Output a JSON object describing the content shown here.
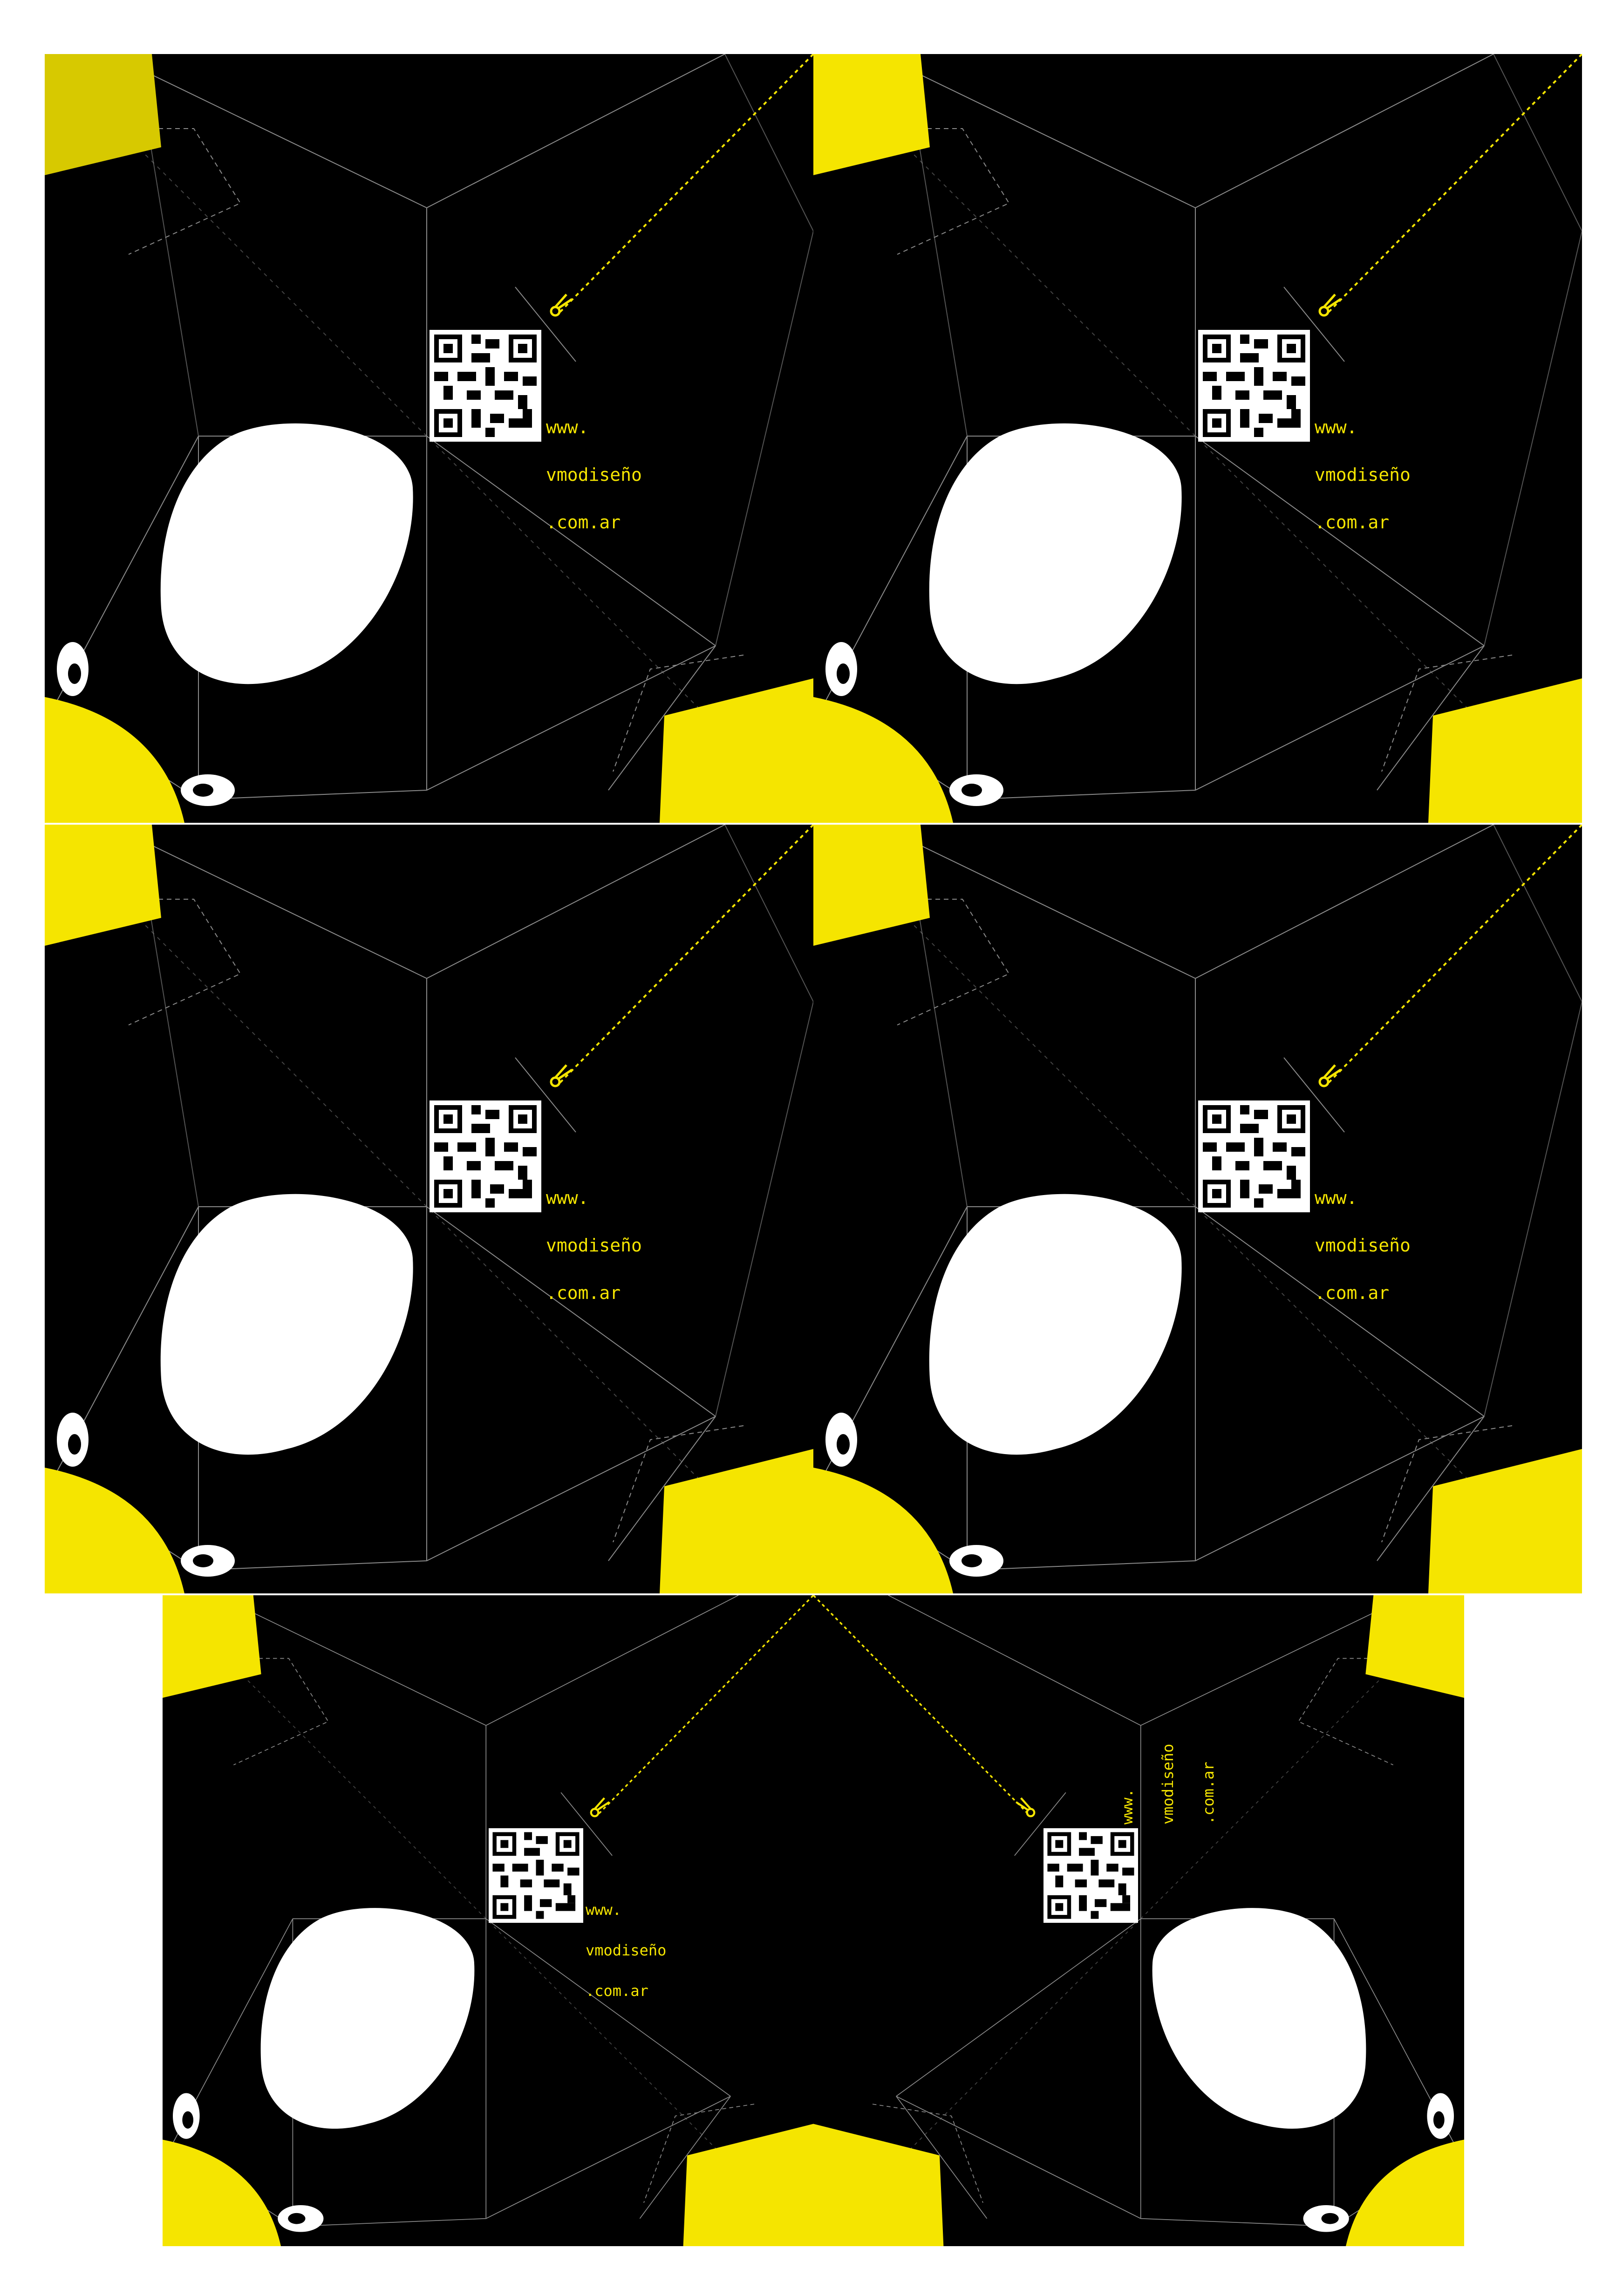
{
  "sheet": {
    "url_lines": [
      "www.",
      "vmodiseño",
      ".com.ar"
    ]
  },
  "colors": {
    "background": "#000000",
    "yellow": "#f5e500",
    "face_white": "#ffffff",
    "fold_lines": "#8a8a8a",
    "cut_line": "#f5e500"
  },
  "icons": {
    "scissors": "scissors-icon",
    "qr": "qr-code-icon"
  }
}
